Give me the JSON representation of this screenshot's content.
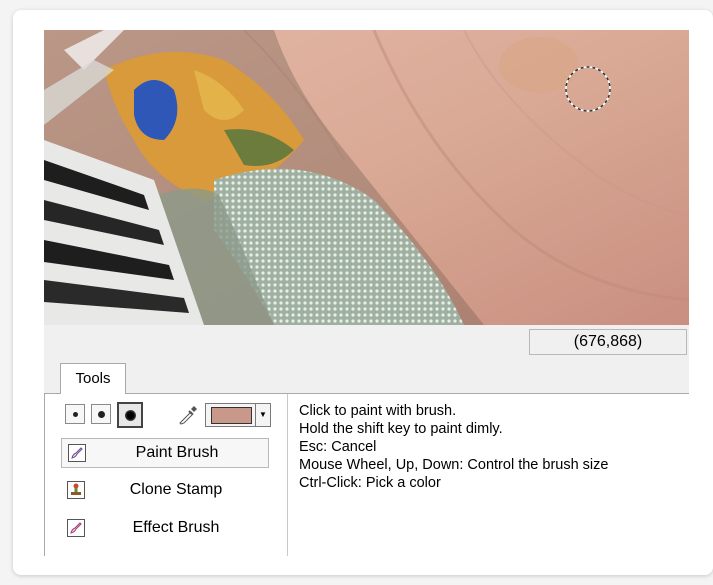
{
  "canvas": {
    "coordinates": "(676,868)",
    "image_subject": "close-up photo of skin with patterned fabric collar"
  },
  "tabs": [
    {
      "label": "Tools",
      "selected": true
    }
  ],
  "tools_panel": {
    "brush_sizes": [
      "small",
      "medium",
      "large"
    ],
    "selected_brush_size": "large",
    "brush_color": "#c8998a",
    "tools": [
      {
        "label": "Paint Brush",
        "icon": "paint-brush-icon",
        "active": true
      },
      {
        "label": "Clone Stamp",
        "icon": "clone-stamp-icon",
        "active": false
      },
      {
        "label": "Effect Brush",
        "icon": "effect-brush-icon",
        "active": false
      }
    ]
  },
  "help_text": [
    "Click to paint with brush.",
    "Hold the shift key to paint dimly.",
    "Esc: Cancel",
    "Mouse Wheel, Up, Down: Control the brush size",
    "Ctrl-Click: Pick a color"
  ]
}
